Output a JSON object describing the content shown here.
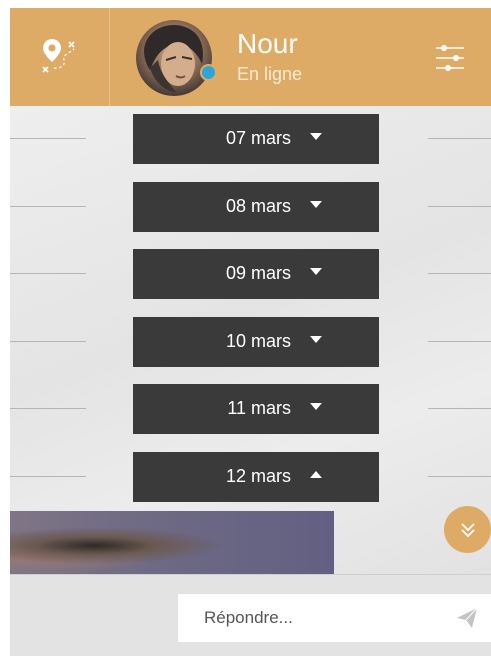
{
  "contact": {
    "name": "Nour",
    "status": "En ligne",
    "status_color": "#2ba6d8"
  },
  "colors": {
    "accent": "#deab67",
    "date_bar": "#3a3a3a",
    "background": "#e6e6e6"
  },
  "header": {
    "left_icon": "map-pin-route-icon",
    "right_icon": "sliders-icon"
  },
  "dates": [
    {
      "label": "07 mars",
      "expanded": false
    },
    {
      "label": "08 mars",
      "expanded": false
    },
    {
      "label": "09 mars",
      "expanded": false
    },
    {
      "label": "10 mars",
      "expanded": false
    },
    {
      "label": "11 mars",
      "expanded": false
    },
    {
      "label": "12 mars",
      "expanded": true
    }
  ],
  "scroll_button_icon": "double-chevron-down-icon",
  "reply": {
    "placeholder": "Répondre...",
    "send_icon": "paper-plane-icon"
  }
}
